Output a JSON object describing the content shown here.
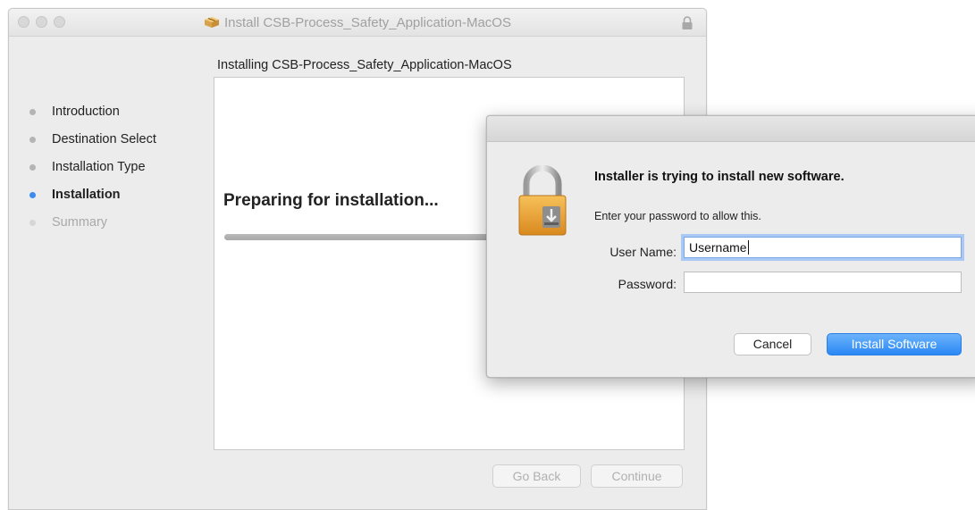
{
  "window": {
    "title": "Install CSB-Process_Safety_Application-MacOS",
    "icon": "package-icon",
    "subtitle": "Installing CSB-Process_Safety_Application-MacOS"
  },
  "steps": [
    {
      "label": "Introduction",
      "state": "done"
    },
    {
      "label": "Destination Select",
      "state": "done"
    },
    {
      "label": "Installation Type",
      "state": "done"
    },
    {
      "label": "Installation",
      "state": "active"
    },
    {
      "label": "Summary",
      "state": "pending"
    }
  ],
  "content": {
    "status": "Preparing for installation...",
    "progress": 0
  },
  "buttons": {
    "go_back": "Go Back",
    "continue": "Continue"
  },
  "auth_dialog": {
    "icon": "padlock-icon",
    "heading": "Installer is trying to install new software.",
    "message": "Enter your password to allow this.",
    "username_label": "User Name:",
    "username_value": "Username",
    "password_label": "Password:",
    "password_value": "",
    "cancel_label": "Cancel",
    "install_label": "Install Software"
  },
  "colors": {
    "accent": "#3b8bf0",
    "primary_button": "#2a88f5",
    "window_bg": "#ececec"
  }
}
